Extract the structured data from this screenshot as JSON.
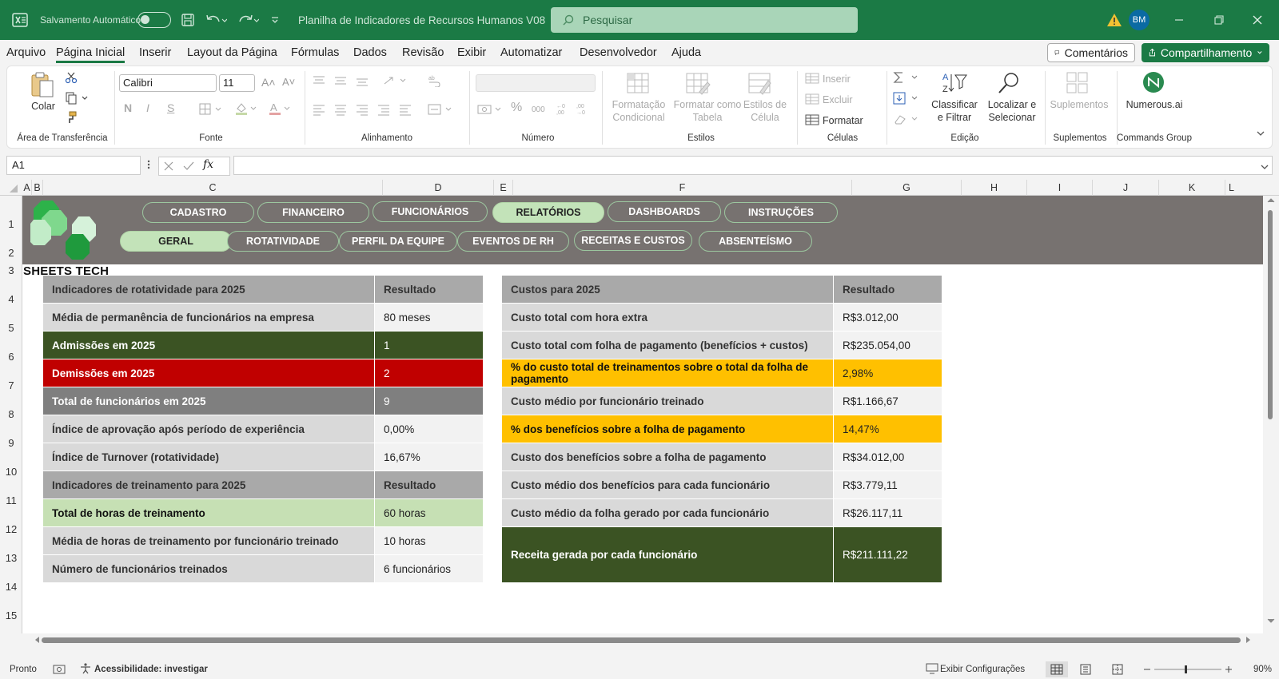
{
  "titlebar": {
    "autosave_label": "Salvamento Automático",
    "doc_title": "Planilha de Indicadores de Recursos Humanos V08",
    "search_placeholder": "Pesquisar",
    "avatar_initials": "BM"
  },
  "menu": {
    "tabs": [
      "Arquivo",
      "Página Inicial",
      "Inserir",
      "Layout da Página",
      "Fórmulas",
      "Dados",
      "Revisão",
      "Exibir",
      "Automatizar",
      "Desenvolvedor",
      "Ajuda"
    ],
    "active": "Página Inicial",
    "comments_label": "Comentários",
    "share_label": "Compartilhamento"
  },
  "ribbon": {
    "clipboard": {
      "paste": "Colar",
      "group": "Área de Transferência"
    },
    "font": {
      "name": "Calibri",
      "size": "11",
      "group": "Fonte",
      "bold": "N",
      "italic": "I",
      "underline": "S"
    },
    "alignment": {
      "group": "Alinhamento"
    },
    "number": {
      "group": "Número",
      "percent": "%",
      "thousands": "000"
    },
    "styles": {
      "conditional": "Formatação Condicional",
      "as_table": "Formatar como Tabela",
      "cell_styles": "Estilos de Célula",
      "group": "Estilos"
    },
    "cells": {
      "insert": "Inserir",
      "delete": "Excluir",
      "format": "Formatar",
      "group": "Células"
    },
    "editing": {
      "sort": "Classificar e Filtrar",
      "find": "Localizar e Selecionar",
      "group": "Edição"
    },
    "addins": {
      "label": "Suplementos",
      "group": "Suplementos"
    },
    "numerous": {
      "label": "Numerous.ai",
      "group": "Commands Group"
    }
  },
  "formula_bar": {
    "name_box": "A1",
    "fx": "fx",
    "formula": ""
  },
  "columns": [
    "A",
    "B",
    "C",
    "D",
    "E",
    "F",
    "G",
    "H",
    "I",
    "J",
    "K",
    "L"
  ],
  "rows": [
    "1",
    "2",
    "3",
    "4",
    "5",
    "6",
    "7",
    "8",
    "9",
    "10",
    "11",
    "12",
    "13",
    "14",
    "15"
  ],
  "nav": {
    "top": [
      "CADASTRO",
      "FINANCEIRO",
      "FUNCIONÁRIOS",
      "RELATÓRIOS",
      "DASHBOARDS",
      "INSTRUÇÕES"
    ],
    "top_active": "RELATÓRIOS",
    "sub": [
      "GERAL",
      "ROTATIVIDADE",
      "PERFIL DA EQUIPE",
      "EVENTOS DE RH",
      "RECEITAS E CUSTOS",
      "ABSENTEÍSMO"
    ],
    "sub_active": "GERAL"
  },
  "brand": "SHEETS TECH",
  "left_table": {
    "rows": [
      {
        "label": "Indicadores de rotatividade para 2025",
        "value": "Resultado",
        "style": "hdr"
      },
      {
        "label": "Média de permanência de funcionários na empresa",
        "value": "80 meses",
        "style": "normal"
      },
      {
        "label": "Admissões em 2025",
        "value": "1",
        "style": "dkgreen"
      },
      {
        "label": "Demissões em 2025",
        "value": "2",
        "style": "red"
      },
      {
        "label": "Total de funcionários em 2025",
        "value": "9",
        "style": "gray"
      },
      {
        "label": "Índice de aprovação após período de experiência",
        "value": "0,00%",
        "style": "normal"
      },
      {
        "label": "Índice de Turnover (rotatividade)",
        "value": "16,67%",
        "style": "normal"
      },
      {
        "label": "Indicadores de treinamento para 2025",
        "value": "Resultado",
        "style": "hdr"
      },
      {
        "label": "Total de horas de treinamento",
        "value": "60 horas",
        "style": "lgreen"
      },
      {
        "label": "Média de horas de treinamento por funcionário treinado",
        "value": "10 horas",
        "style": "normal"
      },
      {
        "label": "Número de funcionários treinados",
        "value": "6 funcionários",
        "style": "normal"
      }
    ]
  },
  "right_table": {
    "rows": [
      {
        "label": "Custos para 2025",
        "value": "Resultado",
        "style": "hdr"
      },
      {
        "label": "Custo total com hora extra",
        "value": "R$3.012,00",
        "style": "normal"
      },
      {
        "label": "Custo total com folha de pagamento (benefícios + custos)",
        "value": "R$235.054,00",
        "style": "normal"
      },
      {
        "label": "% do custo total de treinamentos sobre o total da folha de pagamento",
        "value": "2,98%",
        "style": "gold"
      },
      {
        "label": "Custo médio por funcionário treinado",
        "value": "R$1.166,67",
        "style": "normal"
      },
      {
        "label": "% dos benefícios sobre a folha de pagamento",
        "value": "14,47%",
        "style": "gold"
      },
      {
        "label": "Custo dos benefícios sobre a folha de pagamento",
        "value": "R$34.012,00",
        "style": "normal"
      },
      {
        "label": "Custo médio dos benefícios para cada funcionário",
        "value": "R$3.779,11",
        "style": "normal"
      },
      {
        "label": "Custo médio da folha gerado por cada funcionário",
        "value": "R$26.117,11",
        "style": "normal"
      },
      {
        "label": "Receita gerada por cada funcionário",
        "value": "R$211.111,22",
        "style": "dkgreen"
      }
    ]
  },
  "status": {
    "ready": "Pronto",
    "accessibility": "Acessibilidade: investigar",
    "display_settings": "Exibir Configurações",
    "zoom": "90%"
  },
  "colors": {
    "accent": "#1b7a45",
    "band": "#777270",
    "dark_green": "#3b5323",
    "red": "#c00000",
    "gold": "#ffc000",
    "light_green": "#c6e0b4"
  }
}
